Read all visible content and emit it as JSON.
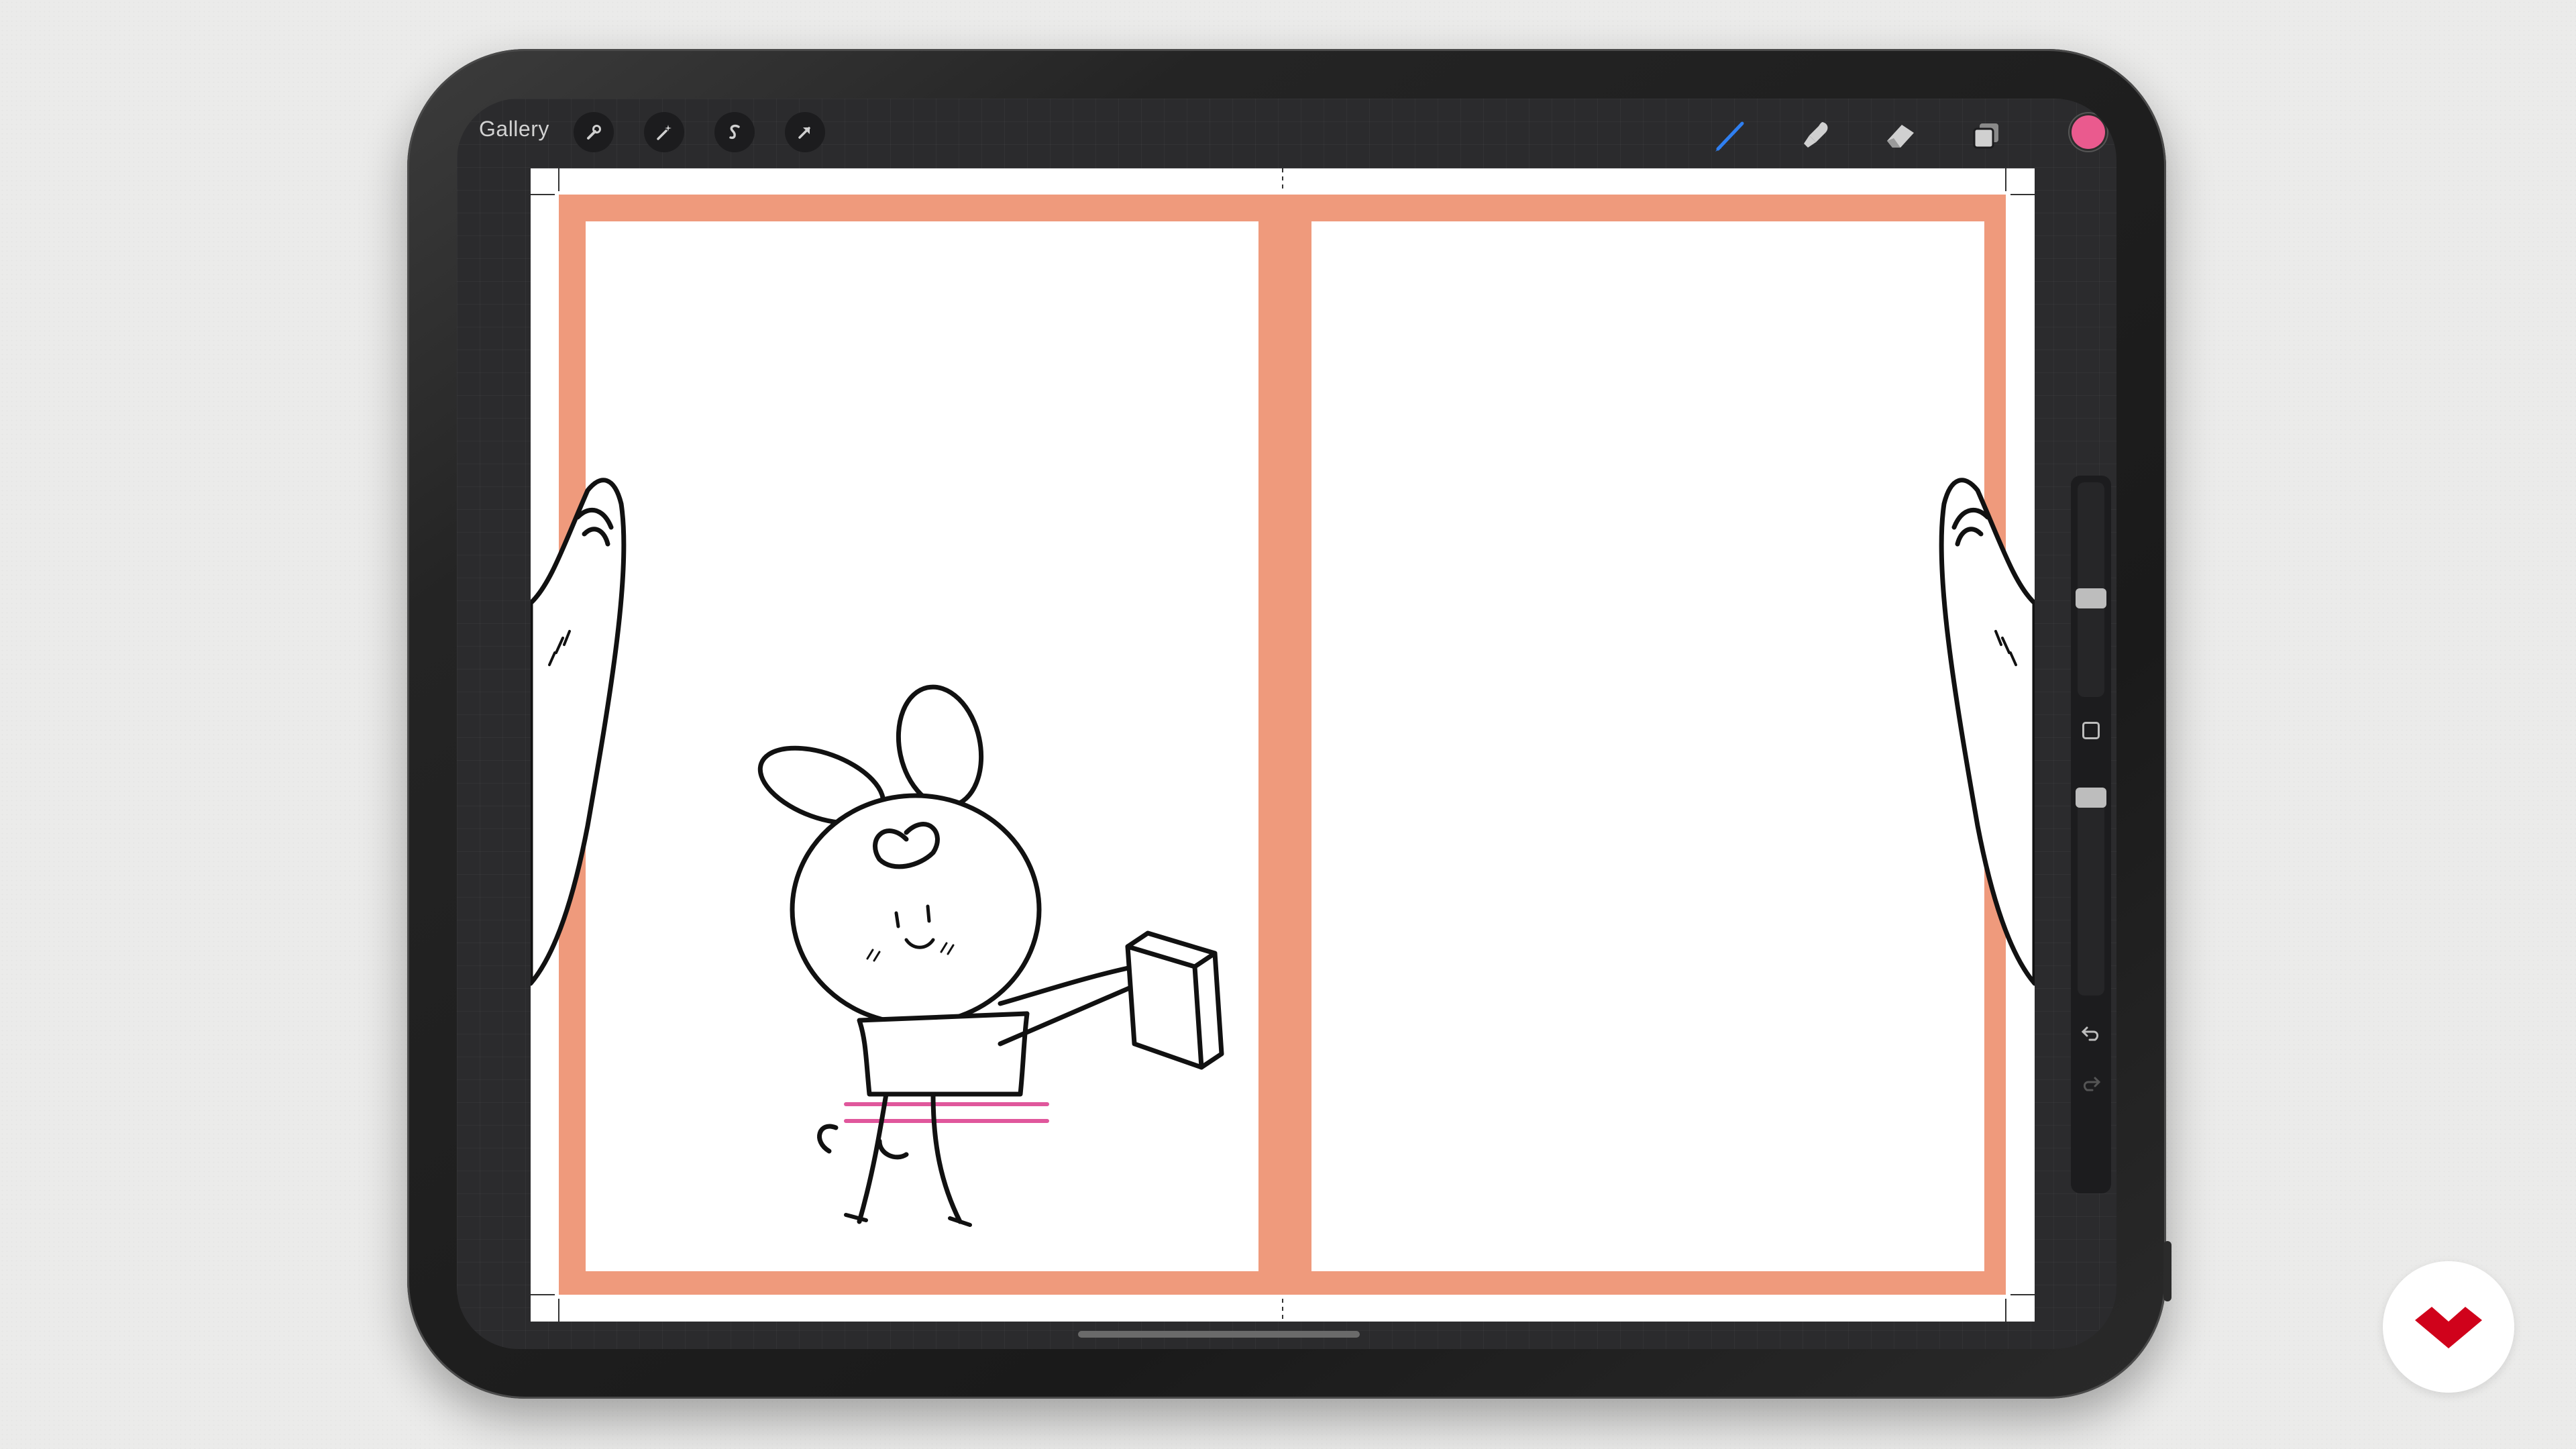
{
  "toolbar": {
    "gallery_label": "Gallery",
    "left_tools": [
      "wrench-icon",
      "magic-wand-icon",
      "selection-icon",
      "transform-arrow-icon"
    ],
    "right_tools": [
      "brush-icon",
      "smudge-icon",
      "eraser-icon",
      "layers-icon"
    ],
    "active_tool": "brush-icon",
    "accent_color": "#2f7ff0",
    "current_color": "#ea5a8e"
  },
  "canvas": {
    "page_border_color": "#ef9a7c",
    "pages": 2,
    "line_color": "#111111",
    "shirt_stripe_color": "#e0579c"
  },
  "sidebar": {
    "brush_size_level": 0.4,
    "opacity_level": 0.05,
    "undo_icon": "undo-icon",
    "redo_icon": "redo-icon"
  },
  "branding": {
    "logo": "domestika-logo",
    "logo_color": "#d0021b"
  }
}
